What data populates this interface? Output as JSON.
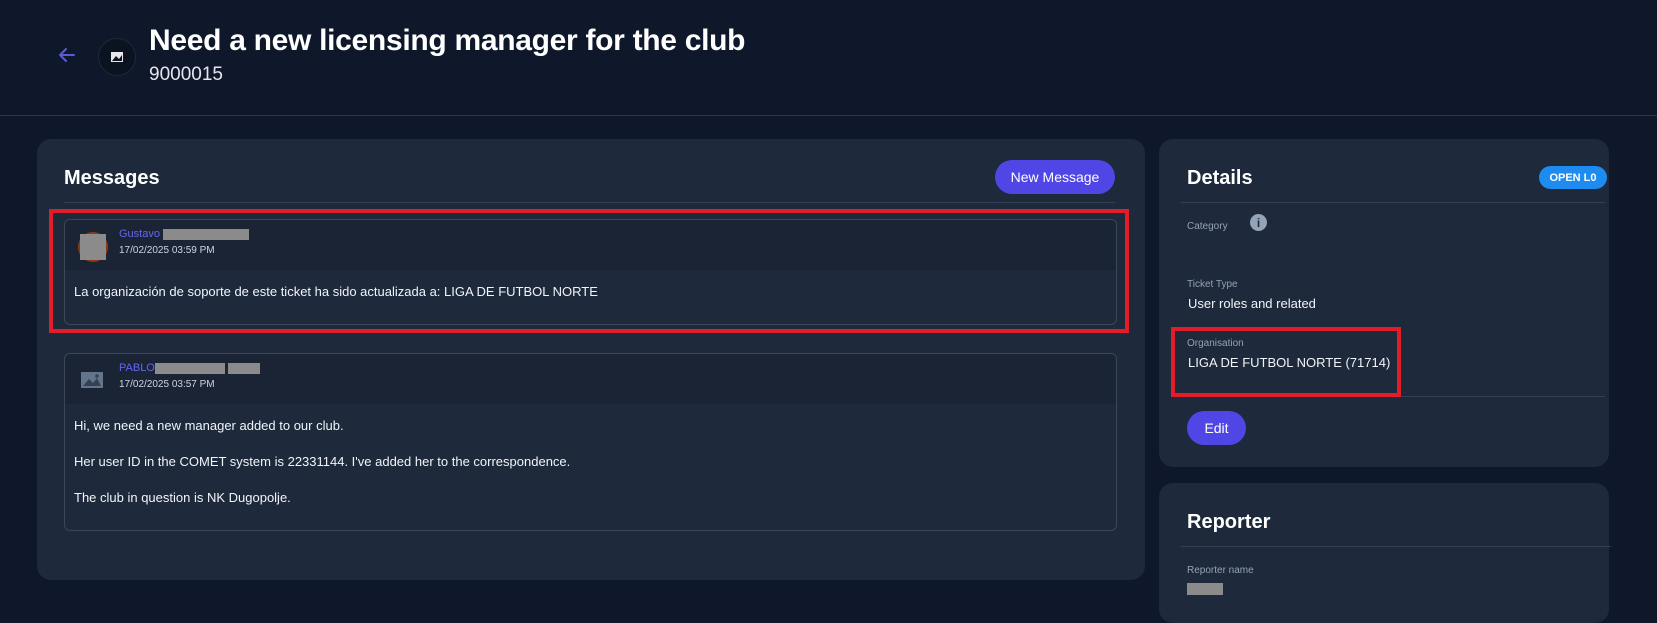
{
  "header": {
    "title": "Need a new licensing manager for the club",
    "ticket_id": "9000015"
  },
  "messages_panel": {
    "title": "Messages",
    "new_message_label": "New Message",
    "messages": [
      {
        "author": "Gustavo",
        "timestamp": "17/02/2025 03:59 PM",
        "body": [
          "La organización de soporte de este ticket ha sido actualizada a: LIGA DE FUTBOL NORTE"
        ]
      },
      {
        "author": "PABLO",
        "timestamp": "17/02/2025 03:57 PM",
        "body": [
          "Hi, we need a new manager added to our club.",
          "Her user ID in the COMET system is 22331144. I've added her to the correspondence.",
          "The club in question is NK Dugopolje."
        ]
      }
    ]
  },
  "details": {
    "title": "Details",
    "status": "OPEN L0",
    "category_label": "Category",
    "ticket_type_label": "Ticket Type",
    "ticket_type_value": "User roles and related",
    "organisation_label": "Organisation",
    "organisation_value": "LIGA DE FUTBOL NORTE (71714)",
    "edit_label": "Edit"
  },
  "reporter": {
    "title": "Reporter",
    "name_label": "Reporter name"
  },
  "colors": {
    "background": "#0f172a",
    "panel": "#1e293b",
    "accent": "#4f46e5",
    "status": "#1d8bf0",
    "highlight": "#e11d2a"
  }
}
